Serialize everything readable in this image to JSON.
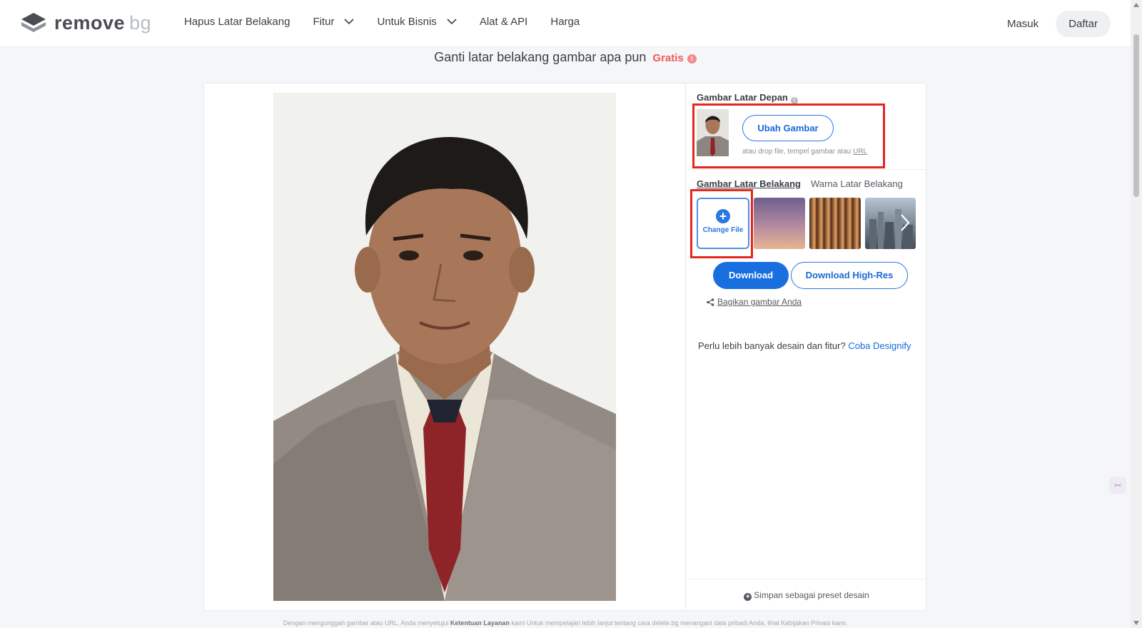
{
  "header": {
    "brand": {
      "word1": "remove",
      "word2": "bg"
    },
    "nav": [
      {
        "label": "Hapus Latar Belakang"
      },
      {
        "label": "Fitur"
      },
      {
        "label": "Untuk Bisnis"
      },
      {
        "label": "Alat & API"
      },
      {
        "label": "Harga"
      }
    ],
    "login_label": "Masuk",
    "signup_label": "Daftar"
  },
  "subtitle": {
    "text": "Ganti latar belakang gambar apa pun",
    "badge": "Gratis",
    "info": "i"
  },
  "panel": {
    "foreground": {
      "title": "Gambar Latar Depan",
      "change_button": "Ubah Gambar",
      "hint_prefix": "atau drop file, tempel gambar atau",
      "hint_link": "URL"
    },
    "tabs": [
      {
        "label": "Gambar Latar Belakang",
        "active": true
      },
      {
        "label": "Warna Latar Belakang",
        "active": false
      }
    ],
    "change_file_label": "Change File",
    "download_label": "Download",
    "download_hires_label": "Download High-Res",
    "share_label": "Bagikan gambar Anda",
    "designify_prefix": "Perlu lebih banyak desain dan fitur?",
    "designify_link": "Coba Designify",
    "preset_label": "Simpan sebagai preset desain"
  },
  "footer": {
    "part1": "Dengan mengunggah gambar atau URL, Anda menyetujui",
    "terms": "Ketentuan Layanan",
    "part2": "kami Untuk mempelajari lebih lanjut tentang cara delete.bg menangani data pribadi Anda, lihat Kebijakan Privasi kami."
  },
  "colors": {
    "accent": "#1a6fe0",
    "highlight_box": "#e5261f",
    "gratis": "#ef5b5b"
  },
  "icons": [
    "logo-icon",
    "chevron-down-icon",
    "info-icon",
    "plus-circle-icon",
    "chevron-right-icon",
    "share-icon"
  ]
}
